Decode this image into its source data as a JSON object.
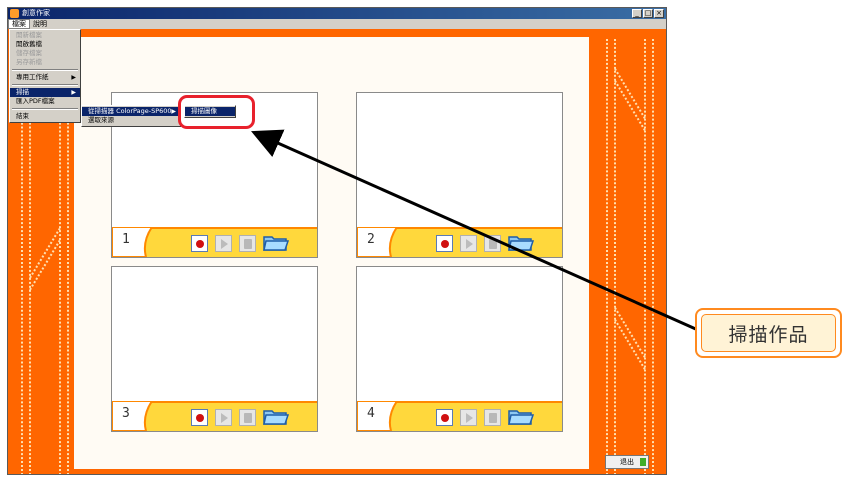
{
  "window": {
    "title": "創意作家",
    "controls": [
      "_",
      "□",
      "×"
    ]
  },
  "menubar": {
    "items": [
      "檔案",
      "說明"
    ]
  },
  "file_menu": {
    "items": [
      {
        "label": "開新檔案",
        "disabled": true
      },
      {
        "label": "開啟舊檔",
        "disabled": false
      },
      {
        "label": "儲存檔案",
        "disabled": true
      },
      {
        "label": "另存新檔",
        "disabled": true
      },
      {
        "label": "專用工作紙",
        "disabled": false,
        "submenu": true
      },
      {
        "label": "掃描",
        "disabled": false,
        "submenu": true,
        "selected": true
      },
      {
        "label": "匯入PDF檔案",
        "disabled": false
      },
      {
        "label": "結束",
        "disabled": false
      }
    ]
  },
  "scan_submenu": {
    "items": [
      {
        "label": "從掃描器 ColorPage-SP600",
        "submenu": true,
        "selected": true
      },
      {
        "label": "選取來源"
      }
    ]
  },
  "scanner_submenu": {
    "items": [
      {
        "label": "掃描圖像",
        "selected": true
      }
    ]
  },
  "slots": [
    {
      "number": "1"
    },
    {
      "number": "2"
    },
    {
      "number": "3"
    },
    {
      "number": "4"
    }
  ],
  "exit_button": {
    "label": "退出"
  },
  "callout": {
    "text": "掃描作品"
  },
  "colors": {
    "background_orange": "#ff6600",
    "toolbar_yellow": "#ffd83c",
    "highlight_red": "#e8212c",
    "callout_border": "#ff8a1f",
    "selection_blue": "#0a246a"
  }
}
